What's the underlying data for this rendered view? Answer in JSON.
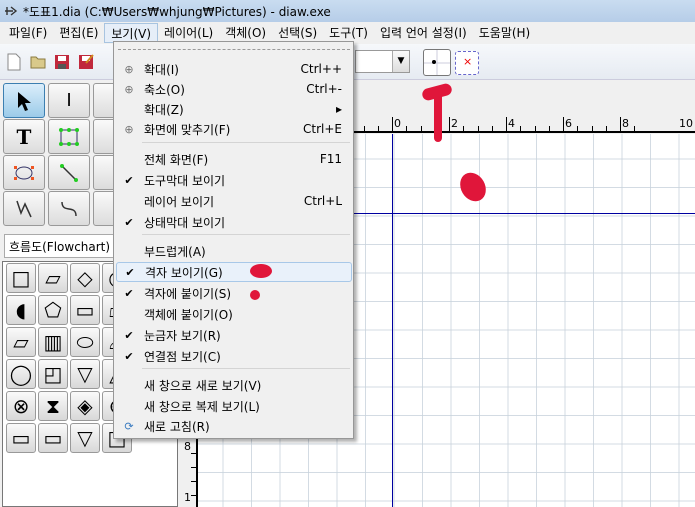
{
  "window": {
    "title": "*도표1.dia (C:₩Users₩whjung₩Pictures) - diaw.exe"
  },
  "menubar": [
    "파일(F)",
    "편집(E)",
    "보기(V)",
    "레이어(L)",
    "객체(O)",
    "선택(S)",
    "도구(T)",
    "입력 언어 설정(I)",
    "도움말(H)"
  ],
  "toolbox": {
    "sheet": "흐름도(Flowchart)"
  },
  "view_menu": {
    "items": [
      {
        "label": "확대(I)",
        "shortcut": "Ctrl++",
        "icon": "zoom-in-icon",
        "checked": false
      },
      {
        "label": "축소(O)",
        "shortcut": "Ctrl+-",
        "icon": "zoom-out-icon",
        "checked": false
      },
      {
        "label": "확대(Z)",
        "shortcut": "▸",
        "checked": false
      },
      {
        "label": "화면에 맞추기(F)",
        "shortcut": "Ctrl+E",
        "icon": "zoom-fit-icon",
        "checked": false
      },
      {
        "label": "전체 화면(F)",
        "shortcut": "F11",
        "checked": false
      },
      {
        "label": "도구막대 보이기",
        "shortcut": "",
        "checked": true
      },
      {
        "label": "레이어 보이기",
        "shortcut": "Ctrl+L",
        "checked": false
      },
      {
        "label": "상태막대 보이기",
        "shortcut": "",
        "checked": true
      },
      {
        "label": "부드럽게(A)",
        "shortcut": "",
        "checked": false
      },
      {
        "label": "격자 보이기(G)",
        "shortcut": "",
        "checked": true
      },
      {
        "label": "격자에 붙이기(S)",
        "shortcut": "",
        "checked": true
      },
      {
        "label": "객체에 붙이기(O)",
        "shortcut": "",
        "checked": false
      },
      {
        "label": "눈금자 보기(R)",
        "shortcut": "",
        "checked": true
      },
      {
        "label": "연결점 보기(C)",
        "shortcut": "",
        "checked": true
      },
      {
        "label": "새 창으로 새로 보기(V)",
        "shortcut": "",
        "checked": false
      },
      {
        "label": "새 창으로 복제  보기(L)",
        "shortcut": "",
        "checked": false
      },
      {
        "label": "새로 고침(R)",
        "shortcut": "",
        "icon": "refresh-icon",
        "checked": false
      }
    ],
    "check_glyph": "✔"
  },
  "ruler": {
    "h_labels": [
      "0",
      "2",
      "4",
      "6",
      "8",
      "10"
    ],
    "v_labels": [
      "8",
      "1"
    ]
  },
  "colors": {
    "annotation": "#e0163a",
    "guide": "#0000a0"
  }
}
